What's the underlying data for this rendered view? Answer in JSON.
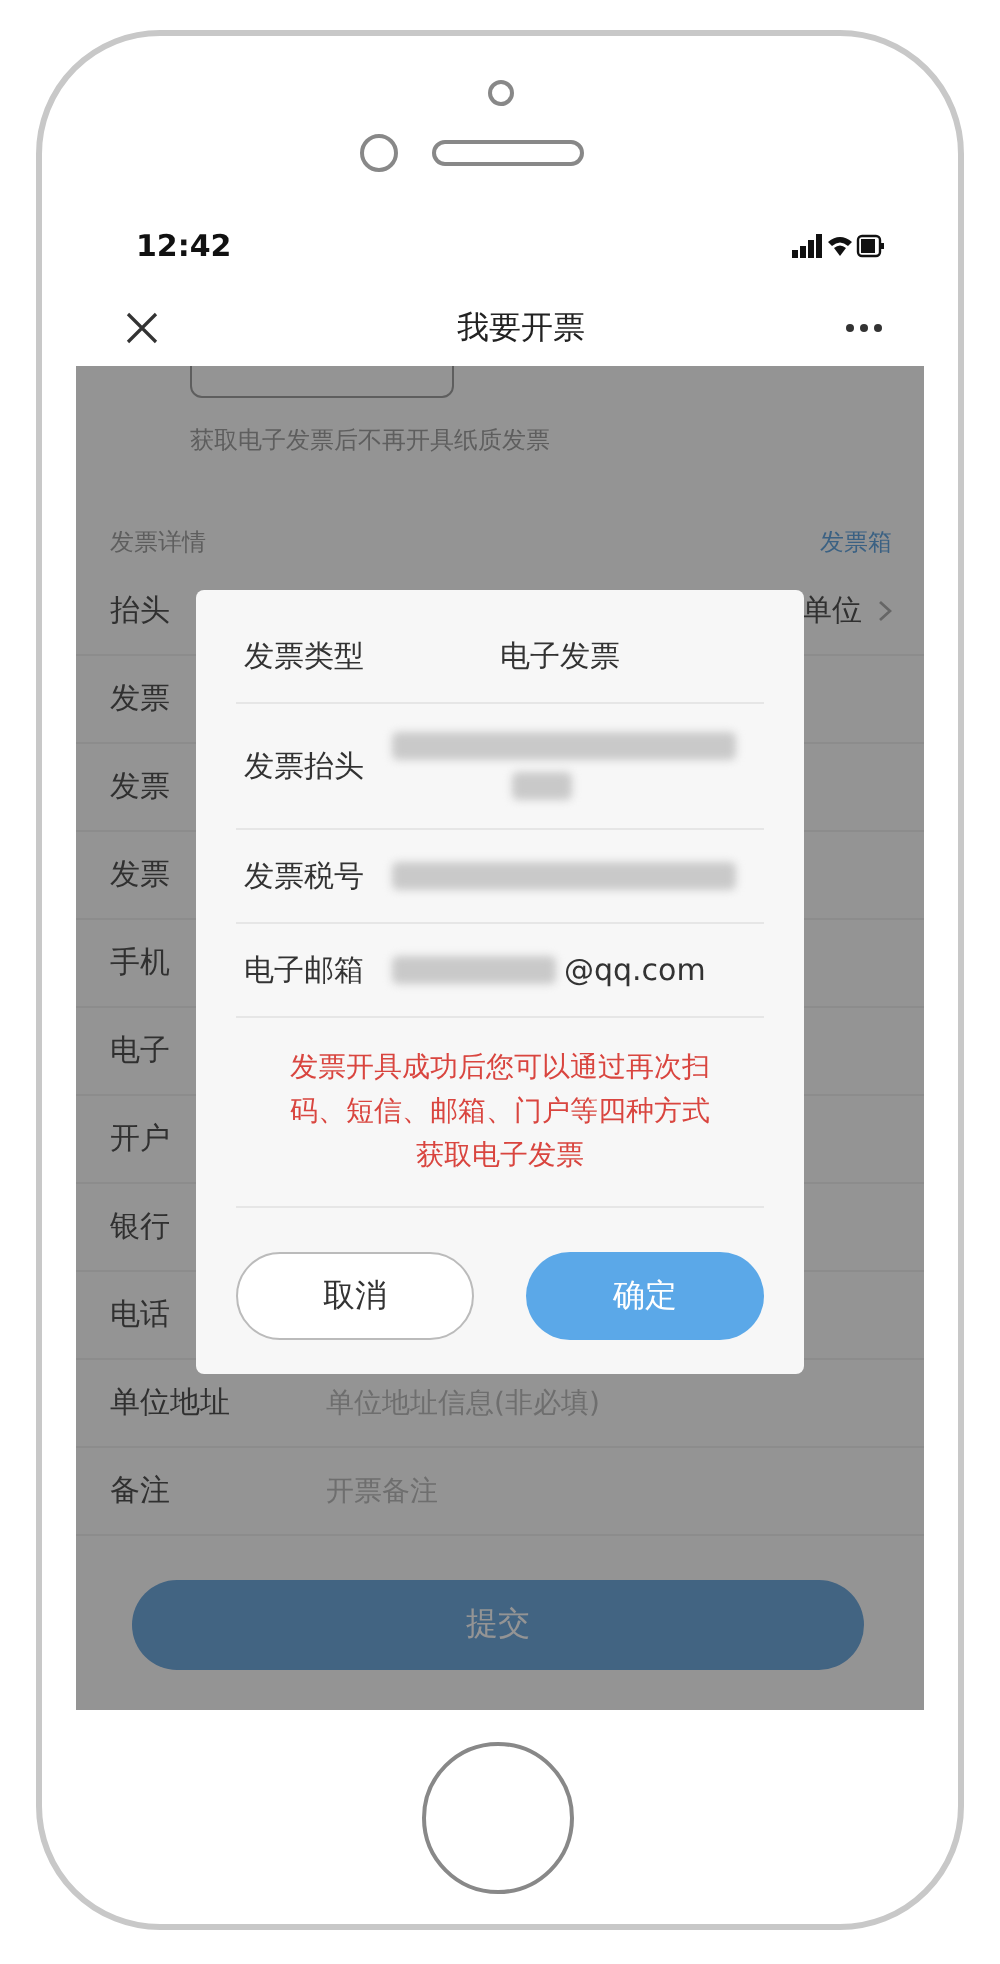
{
  "status_bar": {
    "time": "12:42"
  },
  "nav": {
    "title": "我要开票"
  },
  "form": {
    "note": "获取电子发票后不再开具纸质发票",
    "section_title": "发票详情",
    "section_link": "发票箱",
    "rows": [
      {
        "label": "抬头",
        "kind": "select",
        "value": "单位"
      },
      {
        "label": "发票",
        "kind": "plain"
      },
      {
        "label": "发票",
        "kind": "plain"
      },
      {
        "label": "发票",
        "kind": "plain"
      },
      {
        "label": "手机",
        "kind": "plain"
      },
      {
        "label": "电子",
        "kind": "plain"
      },
      {
        "label": "开户",
        "kind": "plain"
      },
      {
        "label": "银行",
        "kind": "plain"
      },
      {
        "label": "电话",
        "kind": "plain"
      },
      {
        "label": "单位地址",
        "kind": "input",
        "placeholder": "单位地址信息(非必填)"
      },
      {
        "label": "备注",
        "kind": "input",
        "placeholder": "开票备注"
      }
    ],
    "submit": "提交"
  },
  "dialog": {
    "rows": [
      {
        "label": "发票类型",
        "kind": "text",
        "value": "电子发票"
      },
      {
        "label": "发票抬头",
        "kind": "redacted_two_lines"
      },
      {
        "label": "发票税号",
        "kind": "redacted"
      },
      {
        "label": "电子邮箱",
        "kind": "redacted_suffix",
        "value": "@qq.com"
      }
    ],
    "message": "发票开具成功后您可以通过再次扫码、短信、邮箱、门户等四种方式获取电子发票",
    "buttons": [
      {
        "label": "取消",
        "kind": "secondary"
      },
      {
        "label": "确定",
        "kind": "primary"
      }
    ]
  }
}
